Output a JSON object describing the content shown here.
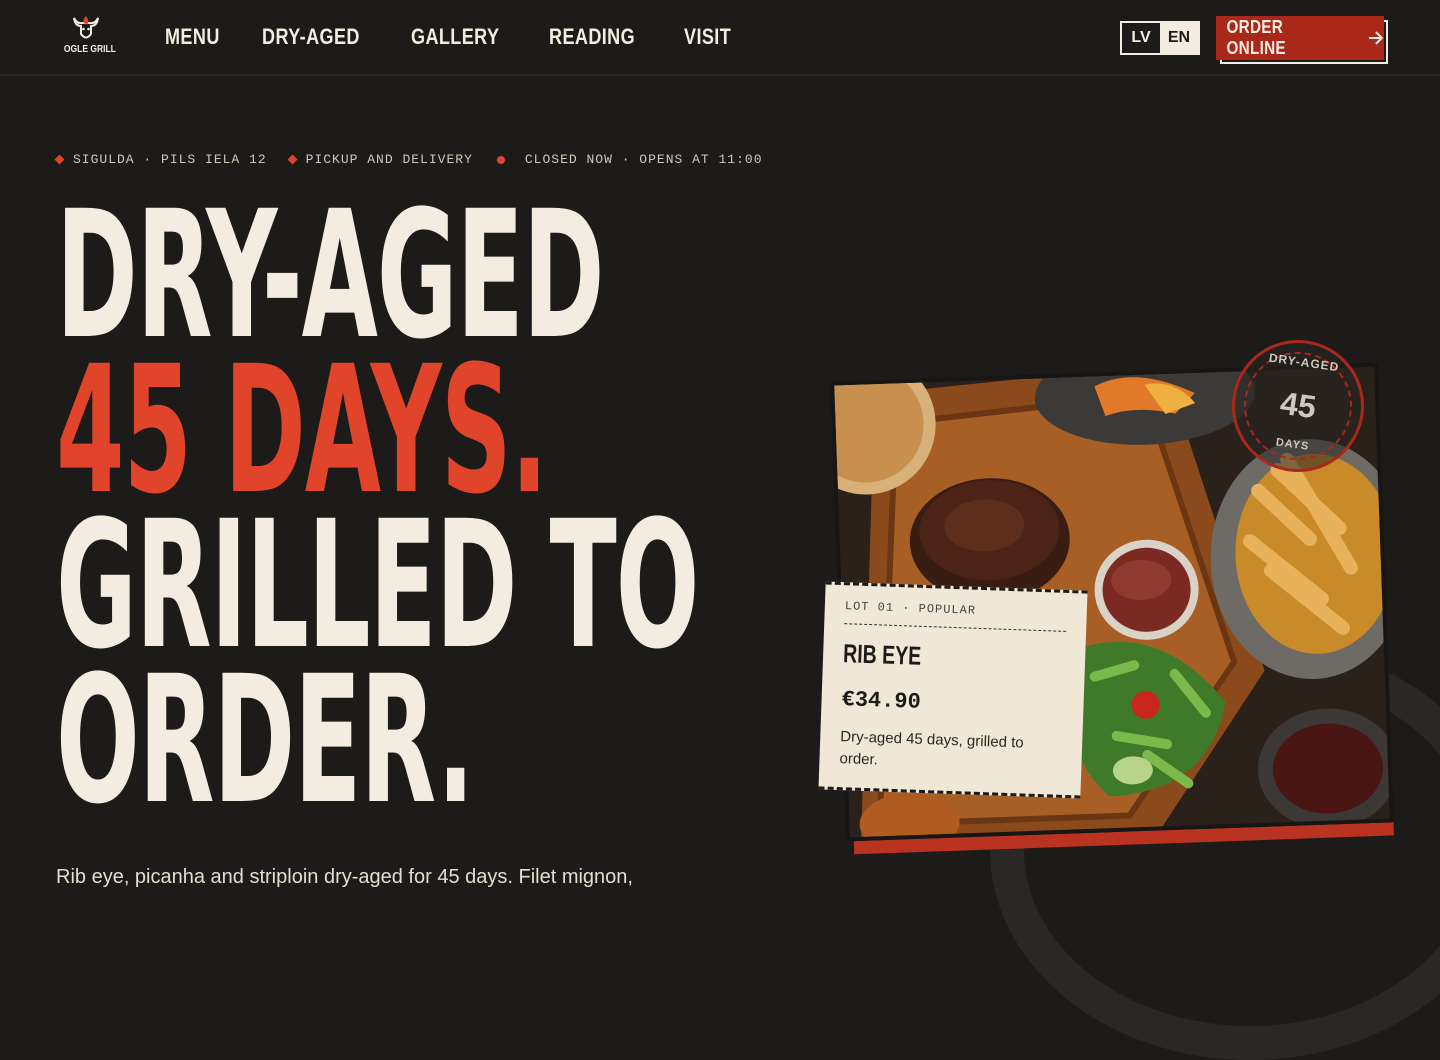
{
  "brand": {
    "name": "OGLE GRILL"
  },
  "nav": {
    "links": [
      "MENU",
      "DRY-AGED",
      "GALLERY",
      "READING",
      "VISIT"
    ],
    "languages": [
      "LV",
      "EN"
    ],
    "active_language": "LV",
    "order_label": "ORDER ONLINE"
  },
  "meta": {
    "location": "SIGULDA · PILS IELA 12",
    "service": "PICKUP AND DELIVERY",
    "status": "CLOSED NOW · OPENS AT 11:00"
  },
  "hero": {
    "line1": "DRY-AGED",
    "line2": "45 DAYS.",
    "line3": "GRILLED TO",
    "line4": "ORDER.",
    "lede": "Rib eye, picanha and striploin dry-aged for 45 days. Filet mignon,"
  },
  "stamp": {
    "top": "DRY-AGED",
    "number": "45",
    "bottom": "DAYS"
  },
  "ticket": {
    "lot": "LOT 01 · POPULAR",
    "name": "RIB EYE",
    "price": "€34.90",
    "description": "Dry-aged 45 days, grilled to order."
  },
  "colors": {
    "accent": "#e0442a",
    "background": "#1c1b19",
    "cream": "#f2ece1",
    "button": "#a9281a"
  },
  "icons": {
    "logo": "bull-flame-icon",
    "order": "arrow-right-icon"
  }
}
